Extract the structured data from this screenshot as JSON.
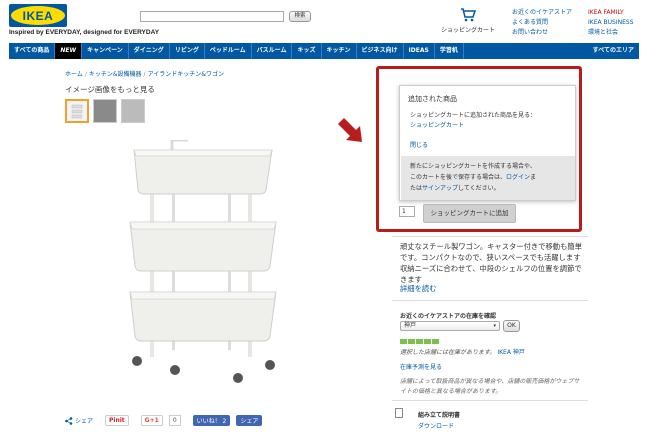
{
  "header": {
    "logo_text": "IKEA",
    "tagline": "Inspired by EVERYDAY, designed for EVERYDAY",
    "search_placeholder": "",
    "search_button": "検索",
    "cart_label": "ショッピングカート",
    "links_col1": [
      "お近くのイケアストア",
      "よくある質問",
      "お問い合わせ"
    ],
    "links_col2": [
      "IKEA FAMILY",
      "IKEA BUSINESS",
      "環境と社会"
    ]
  },
  "nav": {
    "items": [
      "すべての商品",
      "NEW",
      "キャンペーン",
      "ダイニング",
      "リビング",
      "ベッドルーム",
      "バスルーム",
      "キッズ",
      "キッチン",
      "ビジネス向け",
      "IDEAS",
      "学習机"
    ],
    "right_item": "すべてのエリア"
  },
  "breadcrumb": [
    "ホーム",
    "キッチン&設備機器",
    "アイランドキッチン&ワゴン"
  ],
  "image_title": "イメージ画像をもっと見る",
  "popup": {
    "title": "追加された商品",
    "message": "ショッピングカートに追加された商品を見る：",
    "cart_link": "ショッピングカート",
    "close": "閉じる",
    "note_line1": "新たにショッピングカートを作成する場合や、",
    "note_line2_pre": "このカートを後で保存する場合は、",
    "login_link": "ログイン",
    "note_line2_post": "ま",
    "note_line3_pre": "たは",
    "signup_link": "サインアップ",
    "note_line3_post": "してください。"
  },
  "cart_form": {
    "quantity": "1",
    "add_button": "ショッピングカートに追加"
  },
  "description": {
    "text": "頑丈なスチール製ワゴン。キャスター付きで移動も簡単です。コンパクトなので、狭いスペースでも活躍します 収納ニーズに合わせて、中段のシェルフの位置を調節できます",
    "more_link": "詳細を読む"
  },
  "store": {
    "title": "お近くのイケアストアの在庫を確認",
    "selected": "神戸",
    "ok_button": "OK",
    "stock_status": "選択した店舗には在庫があります。",
    "stock_store": "IKEA 神戸",
    "forecast_link": "在庫予測を見る",
    "note": "店舗によって取扱商品が異なる場合や、店舗の販売価格がウェブサイトの価格と異なる場合があります。"
  },
  "assembly": {
    "title": "組み立て説明書",
    "download": "ダウンロード"
  },
  "share": {
    "share_label": "シェア",
    "pin_label": "Pinit",
    "gplus_label": "G+1",
    "gplus_count": "0",
    "like_label": "いいね！ 2",
    "fb_share": "シェア"
  },
  "colors": {
    "ikea_blue": "#0058a3",
    "ikea_yellow": "#ffdb00",
    "highlight_red": "#b81c1c",
    "stock_green": "#7cc04b"
  }
}
